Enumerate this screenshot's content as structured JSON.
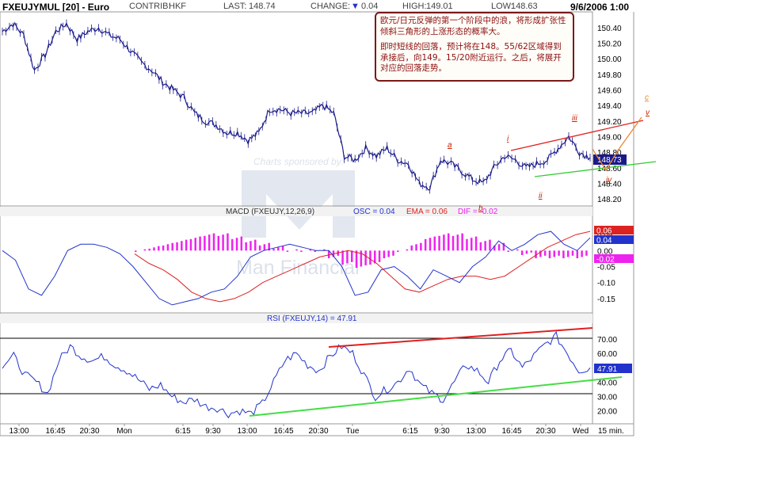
{
  "header": {
    "title": "FXEUJYMUL [20] - Euro",
    "contrib_label": "CONTRIB:",
    "contrib_value": "HKF",
    "last_label": "LAST:",
    "last_value": "148.74",
    "change_label": "CHANGE:",
    "change_value": "0.04",
    "high_label": "HIGH:",
    "high_value": "149.01",
    "low_label": "LOW:",
    "low_value": "148.63",
    "datetime": "9/6/2006 1:00"
  },
  "annotation": {
    "line1": "欧元/日元反弹的第一个阶段中的浪，将形成扩张性倾斜三角形的上涨形态的概率大。",
    "line2": "即时短线的回落，预计将在148。55/62区域得到承接后，向149。15/20附近运行。之后，将展开对应的回落走势。"
  },
  "watermark": {
    "sponsor": "Charts sponsored by:",
    "brand": "Man Financial"
  },
  "colors": {
    "price": "#1a1a8a",
    "trend_red": "#e02020",
    "trend_green": "#33cc33",
    "macd_line": "#2233cc",
    "ema_line": "#dd2222",
    "osc_bars": "#ee22ee",
    "wave_label": "#cc2200",
    "projection": "#ee8833"
  },
  "chart_data": [
    {
      "type": "line",
      "panel": "price",
      "yticks": [
        "150.40",
        "150.20",
        "150.00",
        "149.80",
        "149.60",
        "149.40",
        "149.20",
        "149.00",
        "148.80",
        "148.60",
        "148.40",
        "148.20"
      ],
      "ylim": [
        148.15,
        150.55
      ],
      "last_value_label": "148.73",
      "wave_labels": [
        "a",
        "b",
        "i",
        "ii",
        "iii",
        "iv",
        "v",
        "c"
      ],
      "series": [
        {
          "values": [
            150.35,
            150.45,
            150.3,
            149.85,
            150.05,
            150.35,
            150.45,
            150.25,
            150.35,
            150.4,
            150.3,
            150.25,
            150.1,
            149.95,
            149.85,
            149.7,
            149.6,
            149.5,
            149.3,
            149.2,
            149.15,
            149.05,
            149.05,
            148.95,
            149.05,
            149.35,
            149.35,
            149.3,
            149.3,
            149.3,
            149.4,
            149.3,
            148.75,
            148.7,
            148.85,
            148.75,
            148.85,
            148.7,
            148.65,
            148.4,
            148.35,
            148.7,
            148.65,
            148.55,
            148.45,
            148.4,
            148.6,
            148.75,
            148.7,
            148.6,
            148.65,
            148.7,
            148.85,
            149.0,
            148.8,
            148.73
          ]
        }
      ]
    },
    {
      "type": "line",
      "panel": "macd",
      "title": "MACD (FXEUJY,12,26,9)",
      "osc_label": "OSC = 0.04",
      "ema_label": "EMA = 0.06",
      "dif_label": "DIF = -0.02",
      "yticks": [
        "0.05",
        "0.00",
        "-0.05",
        "-0.10",
        "-0.15"
      ],
      "ylim": [
        -0.19,
        0.1
      ],
      "value_labels": [
        "0.06",
        "0.04",
        "-0.02"
      ],
      "series": [
        {
          "name": "OSC",
          "values": [
            0.0,
            -0.03,
            -0.12,
            -0.14,
            -0.08,
            0.0,
            0.02,
            0.02,
            0.01,
            -0.01,
            -0.05,
            -0.1,
            -0.15,
            -0.17,
            -0.16,
            -0.15,
            -0.13,
            -0.12,
            -0.08,
            -0.02,
            0.0,
            0.01,
            0.02,
            0.01,
            0.0,
            0.0,
            -0.05,
            -0.14,
            -0.13,
            -0.06,
            -0.05,
            -0.08,
            -0.12,
            -0.06,
            -0.08,
            -0.1,
            -0.05,
            -0.02,
            0.03,
            0.0,
            0.02,
            0.05,
            0.06,
            0.02,
            0.0,
            0.04
          ]
        },
        {
          "name": "EMA",
          "values": [
            -0.01,
            -0.04,
            -0.06,
            -0.09,
            -0.13,
            -0.15,
            -0.16,
            -0.15,
            -0.13,
            -0.1,
            -0.08,
            -0.06,
            -0.04,
            -0.02,
            -0.01,
            0.0,
            -0.01,
            -0.04,
            -0.08,
            -0.12,
            -0.13,
            -0.11,
            -0.09,
            -0.08,
            -0.08,
            -0.09,
            -0.08,
            -0.05,
            -0.02,
            0.01,
            0.03,
            0.05,
            0.06
          ]
        },
        {
          "name": "DIF",
          "values": [
            0.0,
            0.01,
            0.02,
            0.03,
            0.04,
            0.05,
            0.05,
            0.04,
            0.03,
            0.02,
            0.01,
            0.0,
            0.0,
            0.0,
            -0.02,
            -0.04,
            -0.05,
            -0.04,
            -0.02,
            0.0,
            0.02,
            0.04,
            0.05,
            0.05,
            0.04,
            0.03,
            0.02,
            0.0,
            -0.01,
            -0.02,
            -0.02,
            -0.02,
            -0.02
          ]
        }
      ]
    },
    {
      "type": "line",
      "panel": "rsi",
      "title": "RSI (FXEUJY,14) = 47.91",
      "yticks": [
        "70.00",
        "60.00",
        "50.00",
        "40.00",
        "30.00",
        "20.00"
      ],
      "ylim": [
        12,
        80
      ],
      "last_value_label": "47.91",
      "series": [
        {
          "values": [
            52,
            58,
            45,
            40,
            32,
            55,
            65,
            58,
            55,
            58,
            52,
            48,
            42,
            35,
            38,
            30,
            26,
            28,
            23,
            22,
            18,
            20,
            18,
            25,
            40,
            55,
            60,
            52,
            48,
            58,
            65,
            60,
            45,
            30,
            35,
            40,
            50,
            38,
            32,
            28,
            40,
            52,
            48,
            40,
            55,
            62,
            50,
            58,
            66,
            72,
            60,
            48,
            50
          ]
        }
      ]
    },
    {
      "type": "line",
      "panel": "x-axis",
      "categories": [
        "13:00",
        "16:45",
        "20:30",
        "Mon",
        "6:15",
        "9:30",
        "13:00",
        "16:45",
        "20:30",
        "Tue",
        "6:15",
        "9:30",
        "13:00",
        "16:45",
        "20:30",
        "Wed"
      ],
      "xlabel": "15 min."
    }
  ]
}
